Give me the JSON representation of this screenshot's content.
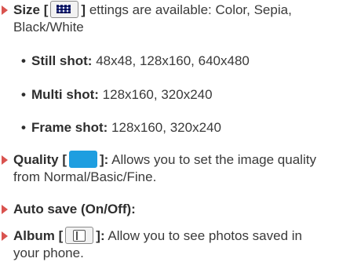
{
  "size": {
    "label": "Size [",
    "close": "]",
    "desc": "ettings are available: Color, Sepia,",
    "desc2": "Black/White",
    "icon": "resolution-grid-icon"
  },
  "sub_items": [
    {
      "label": "Still shot:",
      "value": "48x48, 128x160, 640x480"
    },
    {
      "label": "Multi shot:",
      "value": "128x160, 320x240"
    },
    {
      "label": "Frame shot:",
      "value": "128x160, 320x240"
    }
  ],
  "quality": {
    "label": "Quality [",
    "close": "]:",
    "desc": "Allows you to set the image quality",
    "desc2": "from Normal/Basic/Fine.",
    "icon": "quality-icon"
  },
  "autosave": {
    "label": "Auto save (On/Off):"
  },
  "album": {
    "label": "Album [",
    "close": "]:",
    "desc": "Allow you to see photos saved in",
    "desc2": "your phone.",
    "icon": "album-icon"
  },
  "colors": {
    "arrow": "#d9534f",
    "quality_icon": "#1e9ee0"
  },
  "bullet_char": "•"
}
